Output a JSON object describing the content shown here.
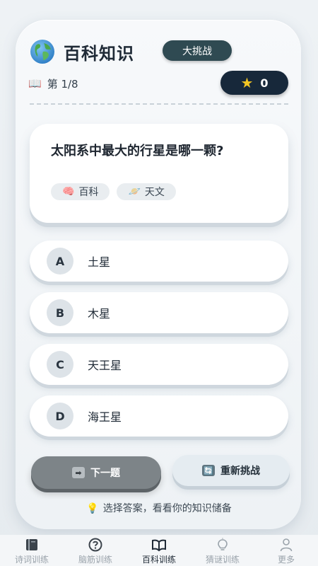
{
  "header": {
    "title": "百科知识",
    "badge": "大挑战",
    "icon": "globe-icon"
  },
  "progress": {
    "book_icon": "📖",
    "label": "第 1/8"
  },
  "score": {
    "star_icon": "★",
    "value": "0"
  },
  "question": {
    "text": "太阳系中最大的行星是哪一颗?",
    "tags": [
      {
        "icon": "🧠",
        "label": "百科"
      },
      {
        "icon": "🪐",
        "label": "天文"
      }
    ]
  },
  "options": [
    {
      "letter": "A",
      "text": "土星"
    },
    {
      "letter": "B",
      "text": "木星"
    },
    {
      "letter": "C",
      "text": "天王星"
    },
    {
      "letter": "D",
      "text": "海王星"
    }
  ],
  "actions": {
    "next_icon": "➡",
    "next_label": "下一题",
    "restart_icon": "🔄",
    "restart_label": "重新挑战"
  },
  "hint": {
    "icon": "💡",
    "text": "选择答案，看看你的知识储备"
  },
  "tabbar": [
    {
      "label": "诗词训练",
      "icon": "book-icon",
      "active": false
    },
    {
      "label": "脑筋训练",
      "icon": "question-icon",
      "active": false
    },
    {
      "label": "百科训练",
      "icon": "open-book-icon",
      "active": true
    },
    {
      "label": "猜谜训练",
      "icon": "lightbulb-icon",
      "active": false
    },
    {
      "label": "更多",
      "icon": "person-icon",
      "active": false
    }
  ],
  "colors": {
    "accent_dark": "#17283a",
    "badge": "#2f4a52",
    "star": "#f3c623"
  }
}
